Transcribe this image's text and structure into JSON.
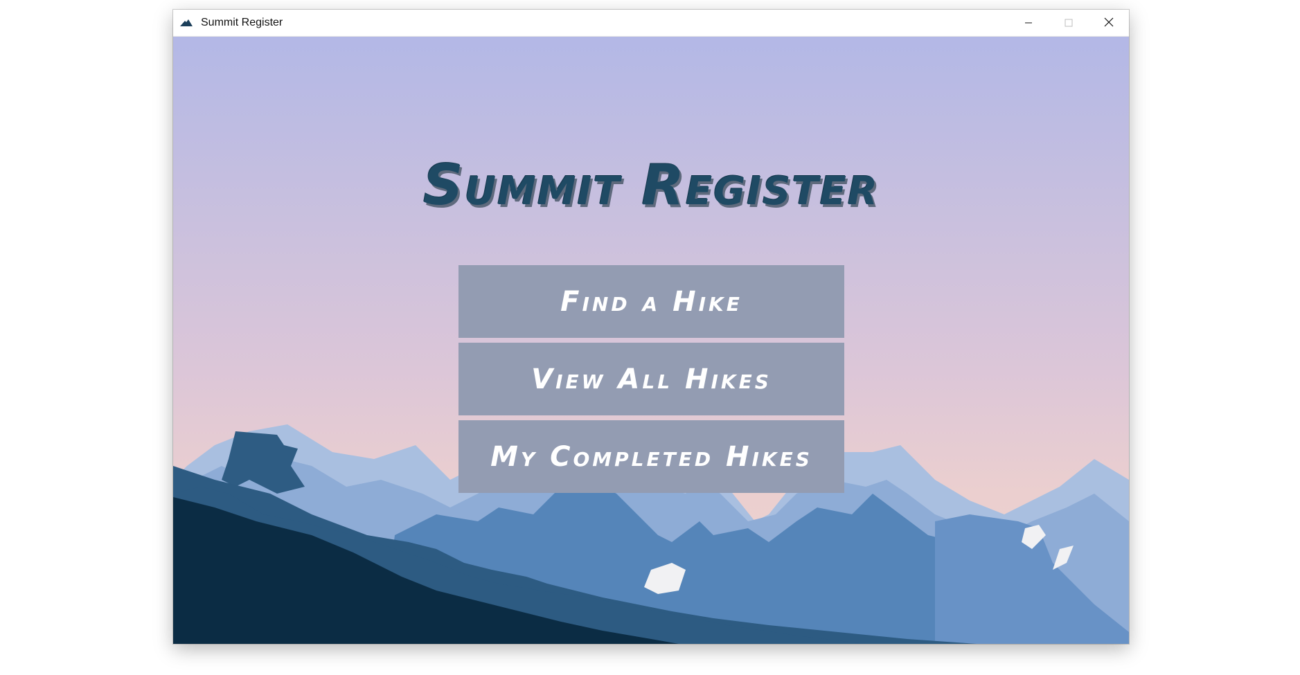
{
  "window": {
    "title": "Summit Register",
    "app_icon": "mountain-icon",
    "controls": [
      "minimize-icon",
      "maximize-icon",
      "close-icon"
    ]
  },
  "main": {
    "heading": "Summit Register",
    "buttons": [
      {
        "label": "Find a Hike"
      },
      {
        "label": "View All Hikes"
      },
      {
        "label": "My Completed Hikes"
      }
    ]
  },
  "colors": {
    "sky_top": "#b3b8e6",
    "sky_bottom": "#edd2cf",
    "button_bg": "#939cb2",
    "heading": "#1f4a64",
    "mountain_dark": "#0b2c44",
    "mountain_mid": "#2d5b82",
    "mountain_light": "#5484b8"
  }
}
